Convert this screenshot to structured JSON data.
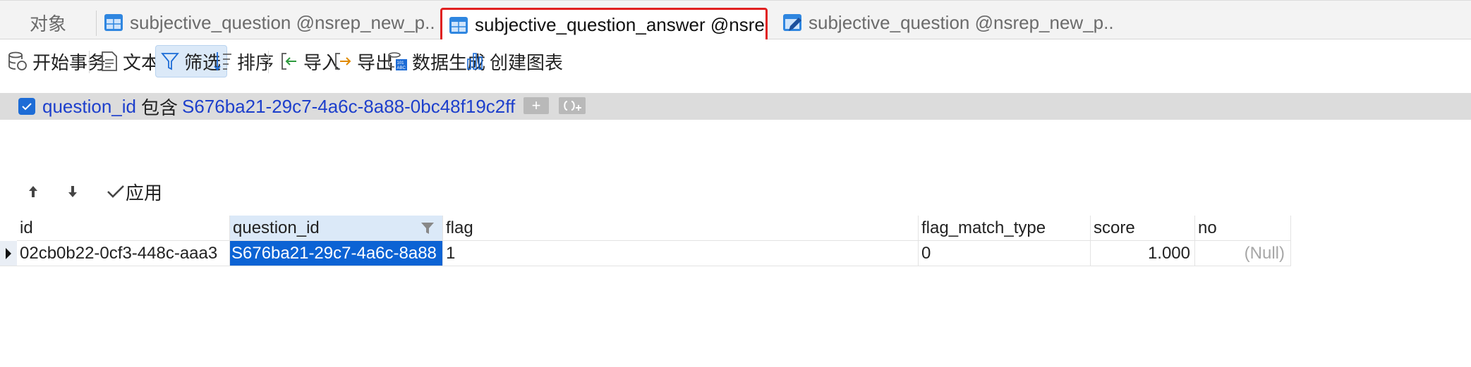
{
  "tabs": [
    {
      "label": "对象"
    },
    {
      "label": "subjective_question @nsrep_new_p..."
    },
    {
      "label": "subjective_question_answer @nsre..."
    },
    {
      "label": "subjective_question @nsrep_new_p..."
    }
  ],
  "toolbar": {
    "begin_transaction": "开始事务",
    "text": "文本",
    "filter": "筛选",
    "sort": "排序",
    "import": "导入",
    "export": "导出",
    "data_generation": "数据生成",
    "create_chart": "创建图表"
  },
  "filter": {
    "field": "question_id",
    "operator": "包含",
    "value": "S676ba21-29c7-4a6c-8a88-0bc48f19c2ff",
    "add_label": "+",
    "checked": true
  },
  "apply_row": {
    "apply_label": "应用"
  },
  "grid": {
    "columns": [
      "id",
      "question_id",
      "flag",
      "flag_match_type",
      "score",
      "no"
    ],
    "rows": [
      [
        "02cb0b22-0cf3-448c-aaa3",
        "S676ba21-29c7-4a6c-8a88",
        "1",
        "0",
        "1.000",
        "(Null)"
      ]
    ]
  },
  "colors": {
    "accent": "#0c63d4",
    "active_tab_outline": "#e02020",
    "header_selected": "#dbe9f8"
  }
}
